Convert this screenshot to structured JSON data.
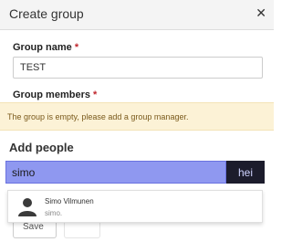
{
  "dialog": {
    "title": "Create group",
    "close_icon": "close-icon"
  },
  "form": {
    "group_name_label": "Group name",
    "required_marker": "*",
    "group_name_value": "TEST",
    "group_members_label": "Group members"
  },
  "warning": {
    "text": "The group is empty, please add a group manager."
  },
  "add_people": {
    "heading": "Add people",
    "search_value": "simo",
    "search_button_label": "hei",
    "results": [
      {
        "name": "Simo Vilmunen",
        "username": "simo.",
        "icon": "person-icon"
      }
    ]
  },
  "footer": {
    "save_label": "Save"
  },
  "colors": {
    "required": "#c0262d",
    "warning_bg": "#fcf2d6",
    "search_highlight": "#8f98f0",
    "search_button_bg": "#1c1c2c"
  }
}
